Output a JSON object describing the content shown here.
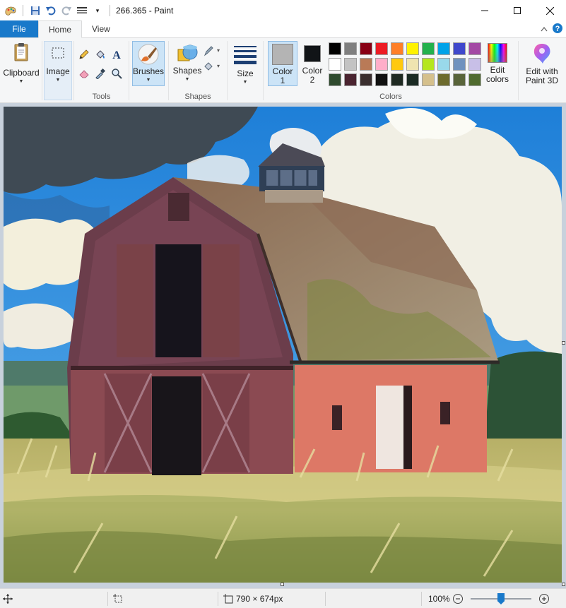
{
  "window": {
    "title": "266.365 - Paint"
  },
  "tabs": {
    "file": "File",
    "home": "Home",
    "view": "View"
  },
  "ribbon": {
    "clipboard": "Clipboard",
    "image": "Image",
    "tools_group": "Tools",
    "brushes": "Brushes",
    "shapes_btn": "Shapes",
    "shapes_group": "Shapes",
    "size": "Size",
    "color1": "Color 1",
    "color2": "Color 2",
    "colors_group": "Colors",
    "edit_colors": "Edit colors",
    "edit_paint3d": "Edit with Paint 3D"
  },
  "palette": {
    "row1": [
      "#000000",
      "#7f7f7f",
      "#880015",
      "#ed1c24",
      "#ff7f27",
      "#fff200",
      "#22b14c",
      "#00a2e8",
      "#3f48cc",
      "#a349a4"
    ],
    "row2": [
      "#ffffff",
      "#c3c3c3",
      "#b97a57",
      "#ffaec9",
      "#ffc90e",
      "#efe4b0",
      "#b5e61d",
      "#99d9ea",
      "#7092be",
      "#c8bfe7"
    ],
    "row3": [
      "#2e4a2e",
      "#4a2430",
      "#3a2f2f",
      "#111111",
      "#1f2a22",
      "#1b2b24",
      "#d5c08c",
      "#6d6b2e",
      "#59643a",
      "#4f6b2e"
    ],
    "color1": "#b4b4b4",
    "color2": "#111417"
  },
  "status": {
    "image_size": "790 × 674px",
    "zoom": "100%"
  }
}
